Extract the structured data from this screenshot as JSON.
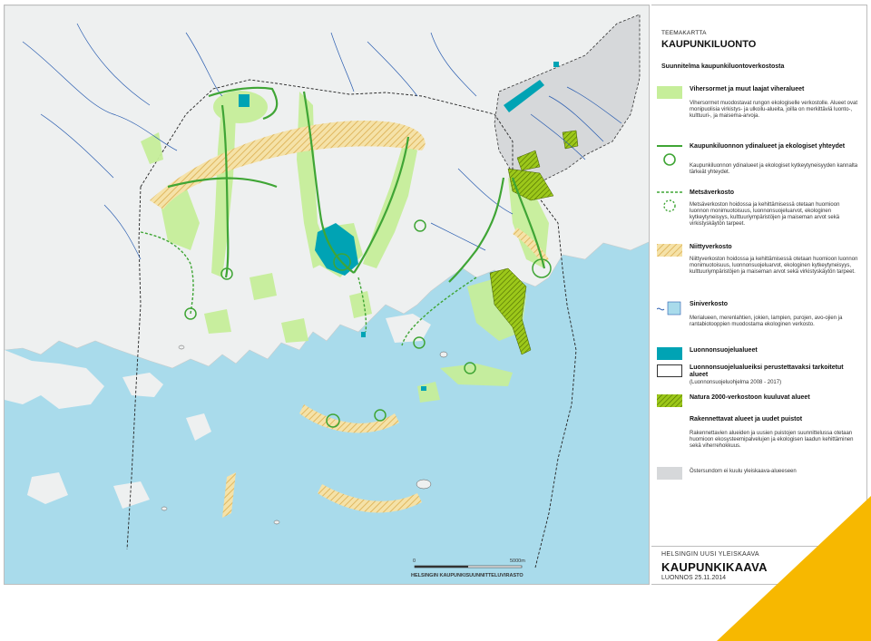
{
  "legend": {
    "supertitle": "TEEMAKARTTA",
    "title": "KAUPUNKILUONTO",
    "heading": "Suunnitelma kaupunkiluontoverkostosta",
    "items": [
      {
        "label": "Vihersormet ja muut laajat viheralueet",
        "desc": "Vihersormet muodostavat rungon ekologiselle verkostolle. Alueet ovat monipuolisia virkistys- ja ulkoilu-alueita, joilla on merkittäviä luonto-, kulttuuri-, ja maisema-arvoja."
      },
      {
        "label": "Kaupunkiluonnon ydinalueet ja ekologiset yhteydet",
        "desc": "Kaupunkiluonnon ydinalueet ja ekologiset kytkeytyneisyyden kannalta tärkeät yhteydet."
      },
      {
        "label": "Metsäverkosto",
        "desc": "Metsäverkoston hoidossa ja kehittämisessä otetaan huomioon luonnon monimuotoisuus, luonnonsuojeluarvot, ekologinen kytkeytyneisyys, kulttuuriympäristöjen ja maiseman arvot sekä virkistyskäytön tarpeet."
      },
      {
        "label": "Niittyverkosto",
        "desc": "Niittyverkoston hoidossa ja kehittämisessä otetaan huomioon luonnon monimuotoisuus, luonnonsuojeluarvot, ekologinen kytkeytyneisyys, kulttuuriympäristöjen ja maiseman arvot sekä virkistyskäytön tarpeet."
      },
      {
        "label": "Siniverkosto",
        "desc": "Merialueen, merenlahtien, jokien, lampien, purojen, avo-ojien ja rantabiotooppien muodostama ekologinen verkosto."
      },
      {
        "label": "Luonnonsuojelualueet",
        "desc": ""
      },
      {
        "label": "Luonnonsuojelualueiksi perustettavaksi tarkoitetut alueet",
        "desc": "(Luonnonsuojeluohjelma 2008 - 2017)"
      },
      {
        "label": "Natura 2000-verkostoon kuuluvat alueet",
        "desc": ""
      },
      {
        "label": "Rakennettavat alueet ja uudet puistot",
        "desc": "Rakennettavien alueiden ja uusien puistojen suunnittelussa otetaan huomioon ekosysteemipalvelujen ja ekologisen laadun kehittäminen sekä viherrehokkuus."
      },
      {
        "label": "",
        "desc": "Östersundom ei kuulu yleiskaava-alueeseen"
      }
    ]
  },
  "titleblock": {
    "supertitle": "HELSINGIN UUSI YLEISKAAVA",
    "title": "KAUPUNKIKAAVA",
    "date": "LUONNOS 25.11.2014"
  },
  "map": {
    "scale_start": "0",
    "scale_end": "5000m",
    "credit": "HELSINGIN KAUPUNKISUUNNITTELUVIRASTO",
    "colors": {
      "sea": "#a9dbeb",
      "land": "#eef0f0",
      "green": "#c6ee9a",
      "corridor": "#3fa535",
      "protected": "#00a3b4",
      "natura": "#8ab400",
      "meadow": "#f2d58a",
      "ostersundom": "#d6d8da",
      "accent": "#f7b800"
    }
  }
}
